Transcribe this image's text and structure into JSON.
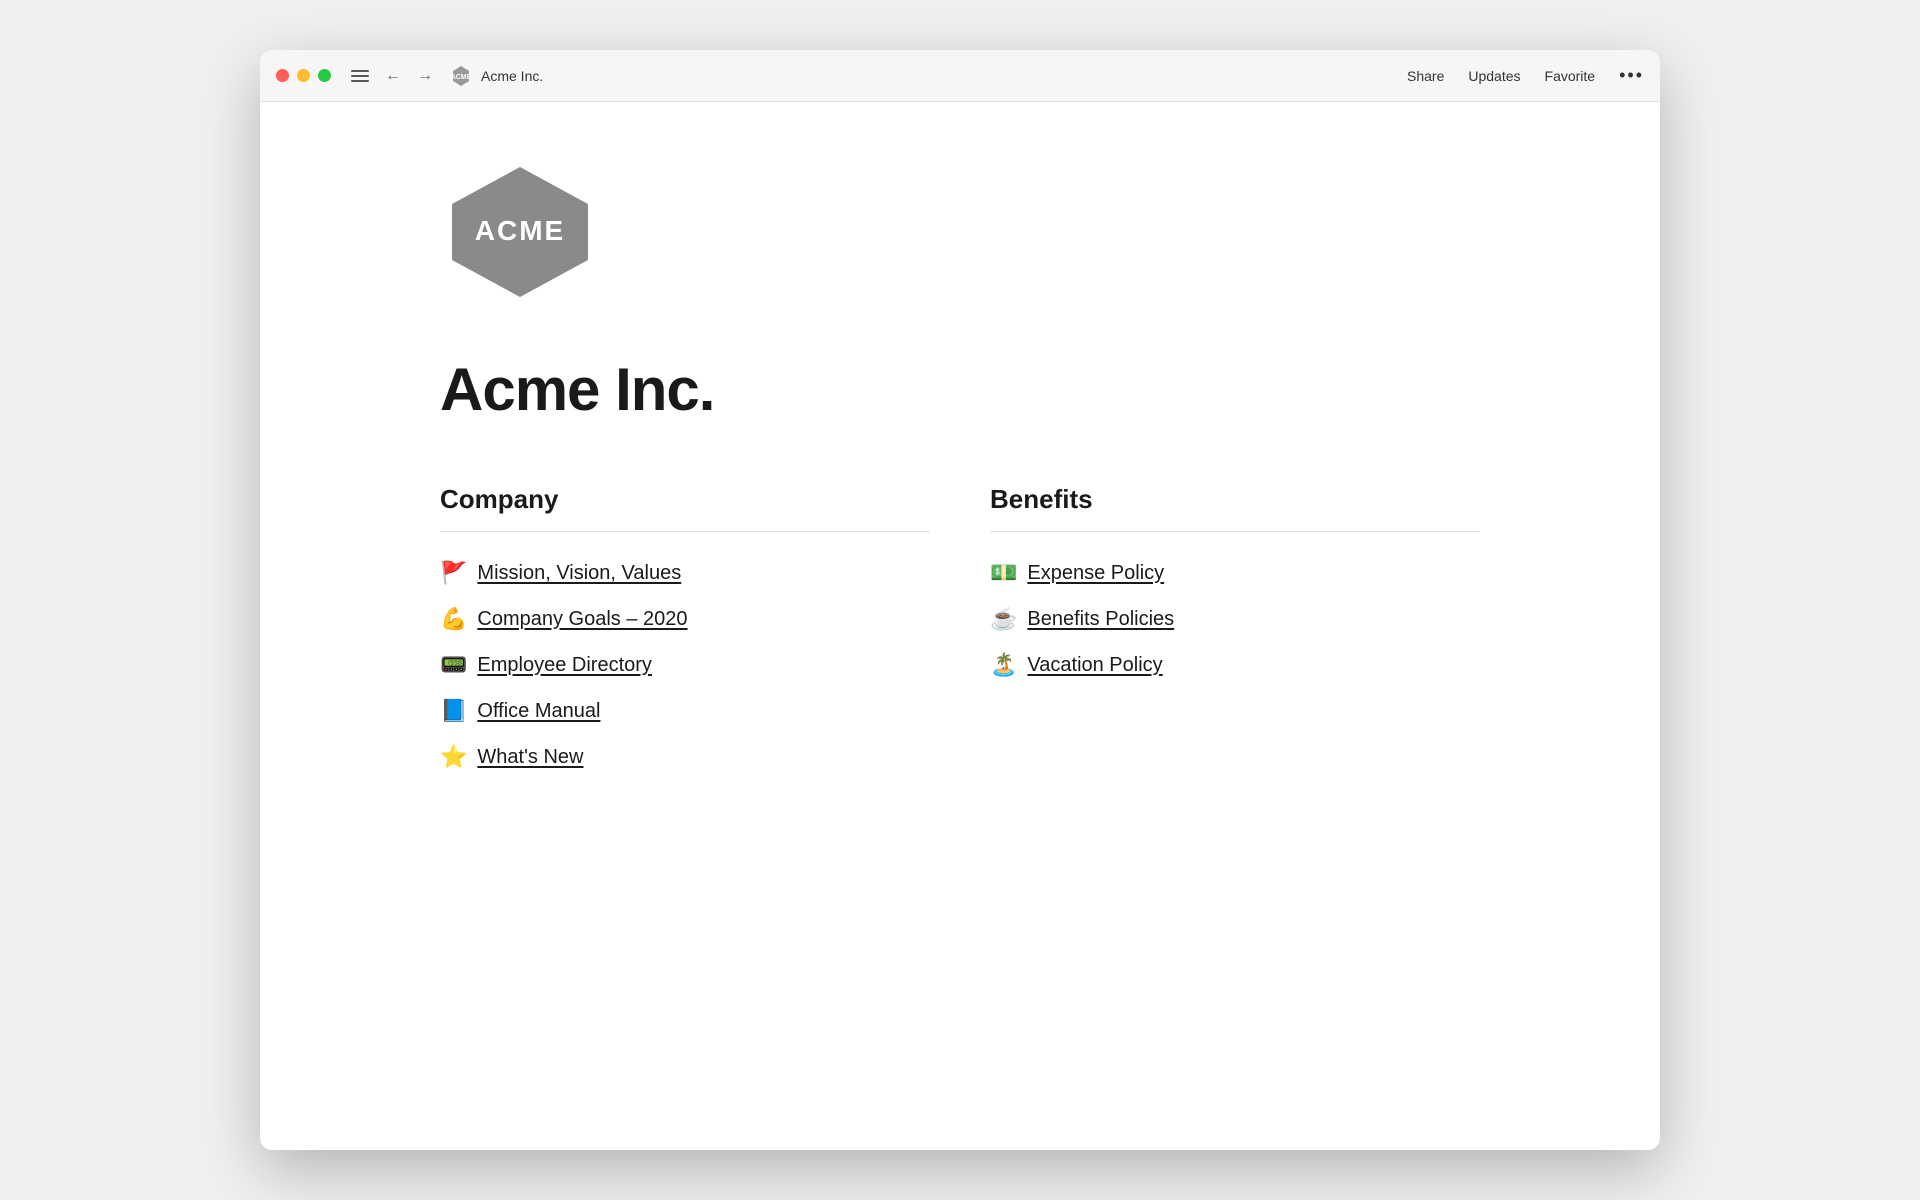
{
  "titleBar": {
    "brandTitle": "Acme Inc.",
    "actions": {
      "share": "Share",
      "updates": "Updates",
      "favorite": "Favorite",
      "more": "•••"
    }
  },
  "page": {
    "title": "Acme Inc.",
    "sections": {
      "company": {
        "heading": "Company",
        "links": [
          {
            "emoji": "🚩",
            "label": "Mission, Vision, Values"
          },
          {
            "emoji": "💪",
            "label": "Company Goals – 2020"
          },
          {
            "emoji": "📟",
            "label": "Employee Directory"
          },
          {
            "emoji": "📘",
            "label": "Office Manual"
          },
          {
            "emoji": "⭐",
            "label": "What's New"
          }
        ]
      },
      "benefits": {
        "heading": "Benefits",
        "links": [
          {
            "emoji": "💵",
            "label": "Expense Policy"
          },
          {
            "emoji": "☕",
            "label": "Benefits Policies"
          },
          {
            "emoji": "🏝️",
            "label": "Vacation Policy"
          }
        ]
      }
    }
  }
}
